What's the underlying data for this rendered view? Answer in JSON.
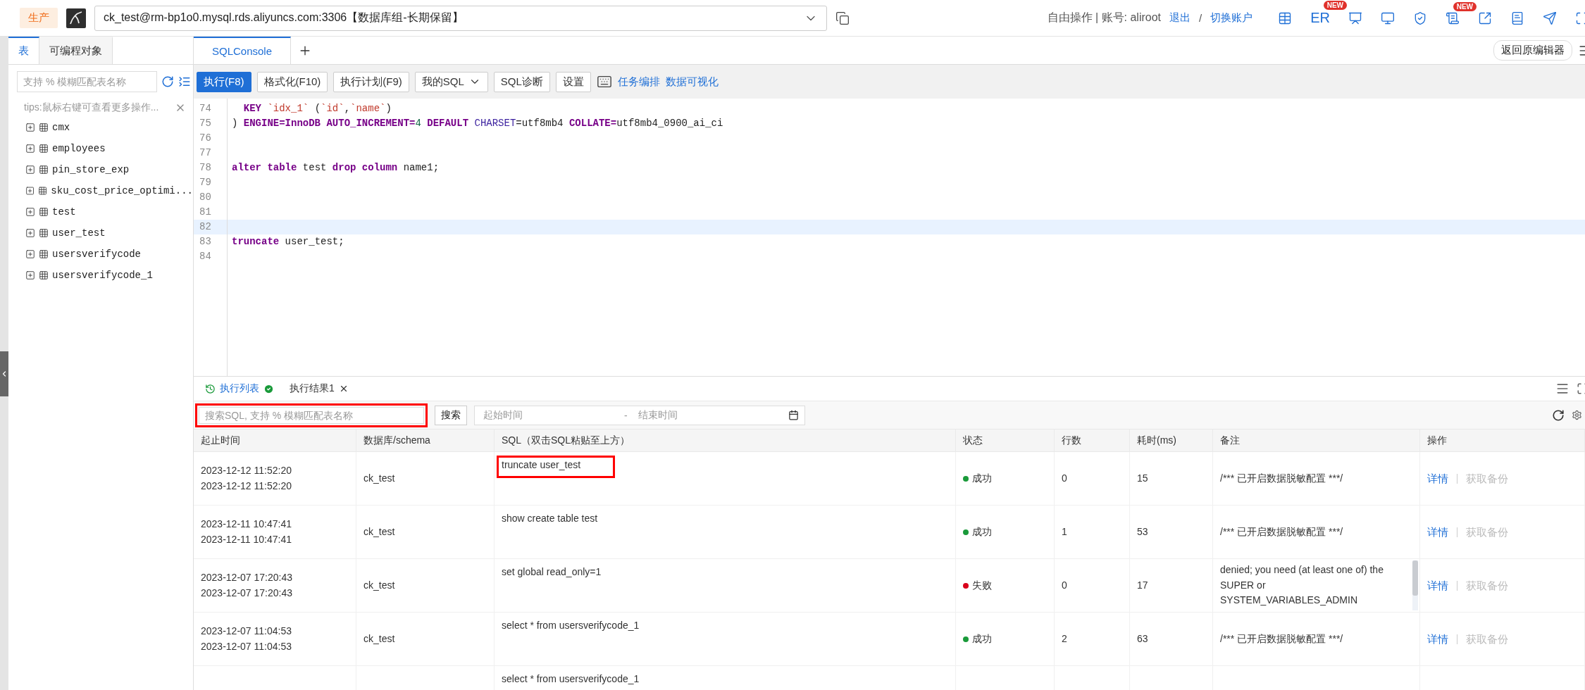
{
  "top_bar": {
    "environment": "生产",
    "connection": "ck_test@rm-bp1o0.mysql.rds.aliyuncs.com:3306【数据库组-长期保留】",
    "account_text": "自由操作 | 账号: aliroot",
    "links": [
      "退出",
      "切换账户"
    ],
    "link_separator": "/",
    "tools": [
      {
        "kind": "icon"
      },
      {
        "kind": "text",
        "label": "ER",
        "badge": "NEW"
      },
      {
        "kind": "icon"
      },
      {
        "kind": "icon"
      },
      {
        "kind": "icon"
      },
      {
        "kind": "icon",
        "badge": "NEW"
      },
      {
        "kind": "icon"
      },
      {
        "kind": "icon"
      },
      {
        "kind": "icon"
      }
    ]
  },
  "sidebar": {
    "tabs": [
      {
        "label": "表",
        "selected": true
      },
      {
        "label": "可编程对象",
        "selected": false
      }
    ],
    "search": {
      "placeholder": "支持 % 模糊匹配表名称"
    },
    "tip": "tips:鼠标右键可查看更多操作...",
    "tables": [
      {
        "name": "cmx",
        "expanded": false
      },
      {
        "name": "employees",
        "expanded": false
      },
      {
        "name": "pin_store_exp",
        "expanded": false
      },
      {
        "name": "sku_cost_price_optimi...",
        "expanded": false
      },
      {
        "name": "test",
        "expanded": false
      },
      {
        "name": "user_test",
        "expanded": false
      },
      {
        "name": "usersverifycode",
        "expanded": false
      },
      {
        "name": "usersverifycode_1",
        "expanded": false
      }
    ]
  },
  "editor": {
    "tabs": [
      {
        "label": "SQLConsole",
        "selected": true
      }
    ],
    "back_button": "返回原编辑器",
    "toolbar": [
      {
        "kind": "primary",
        "label": "执行(F8)"
      },
      {
        "kind": "button",
        "label": "格式化(F10)"
      },
      {
        "kind": "button",
        "label": "执行计划(F9)"
      },
      {
        "kind": "dropdown",
        "label": "我的SQL"
      },
      {
        "kind": "button",
        "label": "SQL诊断"
      },
      {
        "kind": "button",
        "label": "设置"
      },
      {
        "kind": "icon"
      },
      {
        "kind": "link",
        "label": "任务编排"
      },
      {
        "kind": "link",
        "label": "数据可视化"
      }
    ],
    "lines": [
      {
        "number": "74",
        "active": false,
        "indent": true,
        "tokens": [
          {
            "kind": "keyword",
            "text": "KEY"
          },
          {
            "kind": "string",
            "text": " `idx_1`"
          },
          {
            "kind": "plain",
            "text": " ("
          },
          {
            "kind": "string",
            "text": "`id`"
          },
          {
            "kind": "plain",
            "text": ","
          },
          {
            "kind": "string",
            "text": "`name`"
          },
          {
            "kind": "plain",
            "text": ")"
          }
        ]
      },
      {
        "number": "75",
        "active": false,
        "tokens": [
          {
            "kind": "plain",
            "text": ")"
          },
          {
            "kind": "keyword",
            "text": " ENGINE=InnoDB AUTO_INCREMENT="
          },
          {
            "kind": "number",
            "text": "4"
          },
          {
            "kind": "keyword",
            "text": " DEFAULT "
          },
          {
            "kind": "builtin",
            "text": "CHARSET"
          },
          {
            "kind": "plain",
            "text": "=utf8mb4 "
          },
          {
            "kind": "keyword",
            "text": "COLLATE="
          },
          {
            "kind": "plain",
            "text": "utf8mb4_0900_ai_ci"
          }
        ]
      },
      {
        "number": "76",
        "active": false
      },
      {
        "number": "77",
        "active": false
      },
      {
        "number": "78",
        "active": false,
        "tokens": [
          {
            "kind": "keyword",
            "text": "alter table"
          },
          {
            "kind": "plain",
            "text": " test "
          },
          {
            "kind": "keyword",
            "text": "drop column"
          },
          {
            "kind": "plain",
            "text": " name1;"
          }
        ]
      },
      {
        "number": "79",
        "active": false
      },
      {
        "number": "80",
        "active": false
      },
      {
        "number": "81",
        "active": false
      },
      {
        "number": "82",
        "active": true
      },
      {
        "number": "83",
        "active": false,
        "tokens": [
          {
            "kind": "keyword",
            "text": "truncate"
          },
          {
            "kind": "plain",
            "text": " user_test;"
          }
        ]
      },
      {
        "number": "84",
        "active": false
      }
    ]
  },
  "results": {
    "tabs": [
      {
        "label": "执行列表",
        "selected": true,
        "kind": "history"
      },
      {
        "label": "执行结果1",
        "selected": false,
        "kind": "result"
      }
    ],
    "search": {
      "placeholder": "搜索SQL, 支持 % 模糊匹配表名称",
      "highlighted": true
    },
    "search_button": "搜索",
    "date_range": {
      "start_placeholder": "起始时间",
      "separator": "-",
      "end_placeholder": "结束时间"
    },
    "table": {
      "columns": [
        "起止时间",
        "数据库/schema",
        "SQL（双击SQL粘贴至上方）",
        "状态",
        "行数",
        "耗时(ms)",
        "备注",
        "操作"
      ],
      "rows": [
        {
          "start_time": "2023-12-12 11:52:20",
          "end_time": "2023-12-12 11:52:20",
          "schema": "ck_test",
          "sql": "truncate user_test",
          "sql_highlighted": true,
          "status": "成功",
          "color": "#1a9a3a",
          "rows": "0",
          "duration": "15",
          "remark": "/*** 已开启数据脱敏配置 ***/",
          "remark_scrollable": false,
          "actions": [
            {
              "label": "详情",
              "disabled": false
            },
            {
              "label": "获取备份",
              "disabled": true
            }
          ]
        },
        {
          "start_time": "2023-12-11 10:47:41",
          "end_time": "2023-12-11 10:47:41",
          "schema": "ck_test",
          "sql": "show create table test",
          "sql_highlighted": false,
          "status": "成功",
          "color": "#1a9a3a",
          "rows": "1",
          "duration": "53",
          "remark": "/*** 已开启数据脱敏配置 ***/",
          "remark_scrollable": false,
          "actions": [
            {
              "label": "详情",
              "disabled": false
            },
            {
              "label": "获取备份",
              "disabled": true
            }
          ]
        },
        {
          "start_time": "2023-12-07 17:20:43",
          "end_time": "2023-12-07 17:20:43",
          "schema": "ck_test",
          "sql": "set global read_only=1",
          "sql_highlighted": false,
          "status": "失败",
          "color": "#d9001b",
          "rows": "0",
          "duration": "17",
          "remark": "denied; you need (at least one of) the SUPER or SYSTEM_VARIABLES_ADMIN",
          "remark_scrollable": true,
          "actions": [
            {
              "label": "详情",
              "disabled": false
            },
            {
              "label": "获取备份",
              "disabled": true
            }
          ]
        },
        {
          "start_time": "2023-12-07 11:04:53",
          "end_time": "2023-12-07 11:04:53",
          "schema": "ck_test",
          "sql": "select * from usersverifycode_1",
          "sql_highlighted": false,
          "status": "成功",
          "color": "#1a9a3a",
          "rows": "2",
          "duration": "63",
          "remark": "/*** 已开启数据脱敏配置 ***/",
          "remark_scrollable": false,
          "actions": [
            {
              "label": "详情",
              "disabled": false
            },
            {
              "label": "获取备份",
              "disabled": true
            }
          ]
        },
        {
          "sql": "select * from usersverifycode_1",
          "sql_highlighted": false
        }
      ]
    }
  }
}
